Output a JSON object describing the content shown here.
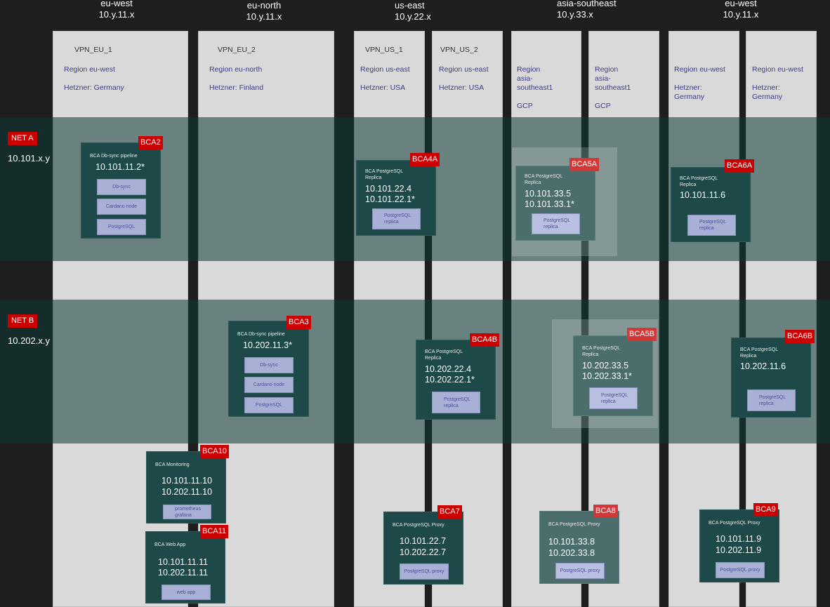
{
  "regions": [
    {
      "name": "eu-west",
      "subnet": "10.y.11.x"
    },
    {
      "name": "eu-north",
      "subnet": "10.y.11.x"
    },
    {
      "name": "us-east",
      "subnet": "10.y.22.x"
    },
    {
      "name": "asia-southeast",
      "subnet": "10.y.33.x"
    },
    {
      "name": "eu-west",
      "subnet": "10.y.11.x"
    }
  ],
  "columns": [
    {
      "vpn": "VPN_EU_1",
      "region": "Region eu-west",
      "provider": "Hetzner: Germany"
    },
    {
      "vpn": "VPN_EU_2",
      "region": "Region eu-north",
      "provider": "Hetzner: Finland"
    },
    {
      "vpn": "VPN_US_1",
      "region": "Region us-east",
      "provider": "Hetzner: USA"
    },
    {
      "vpn": "VPN_US_2",
      "region": "Region us-east",
      "provider": "Hetzner: USA"
    },
    {
      "vpn": "",
      "region": "Region\nasia-\nsoutheast1",
      "provider": "GCP"
    },
    {
      "vpn": "",
      "region": "Region\nasia-\nsoutheast1",
      "provider": "GCP"
    },
    {
      "vpn": "",
      "region": "Region eu-west",
      "provider": "Hetzner:\nGermany"
    },
    {
      "vpn": "",
      "region": "Region eu-west",
      "provider": "Hetzner:\nGermany"
    }
  ],
  "networks": [
    {
      "label": "NET A",
      "range": "10.101.x.y"
    },
    {
      "label": "NET B",
      "range": "10.202.x.y"
    }
  ],
  "vms": [
    {
      "tag": "BCA2",
      "title": "BCA Db-sync pipeline",
      "ips": [
        "10.101.11.2*"
      ],
      "services": [
        "Db-sync",
        "Cardano node",
        "PostgreSQL"
      ]
    },
    {
      "tag": "BCA3",
      "title": "BCA Db-sync pipeline",
      "ips": [
        "10.202.11.3*"
      ],
      "services": [
        "Db-sync",
        "Cardano node",
        "PostgreSQL"
      ]
    },
    {
      "tag": "BCA4A",
      "title": "BCA PostgreSQL\nReplica",
      "ips": [
        "10.101.22.4",
        "10.101.22.1*"
      ],
      "services": [
        "PostgreSQL\nreplica"
      ]
    },
    {
      "tag": "BCA4B",
      "title": "BCA PostgreSQL\nReplica",
      "ips": [
        "10.202.22.4",
        "10.202.22.1*"
      ],
      "services": [
        "PostgreSQL\nreplica"
      ]
    },
    {
      "tag": "BCA5A",
      "title": "BCA PostgreSQL\nReplica",
      "ips": [
        "10.101.33.5",
        "10.101.33.1*"
      ],
      "services": [
        "PostgreSQL\nreplica"
      ],
      "faded": true
    },
    {
      "tag": "BCA5B",
      "title": "BCA PostgreSQL\nReplica",
      "ips": [
        "10.202.33.5",
        "10.202.33.1*"
      ],
      "services": [
        "PostgreSQL\nreplica"
      ],
      "faded": true
    },
    {
      "tag": "BCA6A",
      "title": "BCA PostgreSQL\nReplica",
      "ips": [
        "10.101.11.6"
      ],
      "services": [
        "PostgreSQL\nreplica"
      ]
    },
    {
      "tag": "BCA6B",
      "title": "BCA PostgreSQL\nReplica",
      "ips": [
        "10.202.11.6"
      ],
      "services": [
        "PostgreSQL\nreplica"
      ]
    },
    {
      "tag": "BCA7",
      "title": "BCA PostgreSQL Proxy",
      "ips": [
        "10.101.22.7",
        "10.202.22.7"
      ],
      "services": [
        "PostgreSQL proxy"
      ]
    },
    {
      "tag": "BCA8",
      "title": "BCA PostgreSQL Proxy",
      "ips": [
        "10.101.33.8",
        "10.202.33.8"
      ],
      "services": [
        "PostgreSQL proxy"
      ],
      "faded": true
    },
    {
      "tag": "BCA9",
      "title": "BCA PostgreSQL Proxy",
      "ips": [
        "10.101.11.9",
        "10.202.11.9"
      ],
      "services": [
        "PostgreSQL proxy"
      ]
    },
    {
      "tag": "BCA10",
      "title": "BCA Monitoring",
      "ips": [
        "10.101.11.10",
        "10.202.11.10"
      ],
      "services": [
        "prometheus\ngrafana"
      ]
    },
    {
      "tag": "BCA11",
      "title": "BCA Web App",
      "ips": [
        "10.101.11.11",
        "10.202.11.11"
      ],
      "services": [
        "web app"
      ]
    }
  ],
  "colors": {
    "background": "#1e1e1e",
    "column": "#d9d9d9",
    "vm_box": "#1d4948",
    "vm_box_faded": "#4b6d6b",
    "tag": "#cc0000",
    "service": "#a9b0d6",
    "info_text": "#3e3d8c"
  }
}
